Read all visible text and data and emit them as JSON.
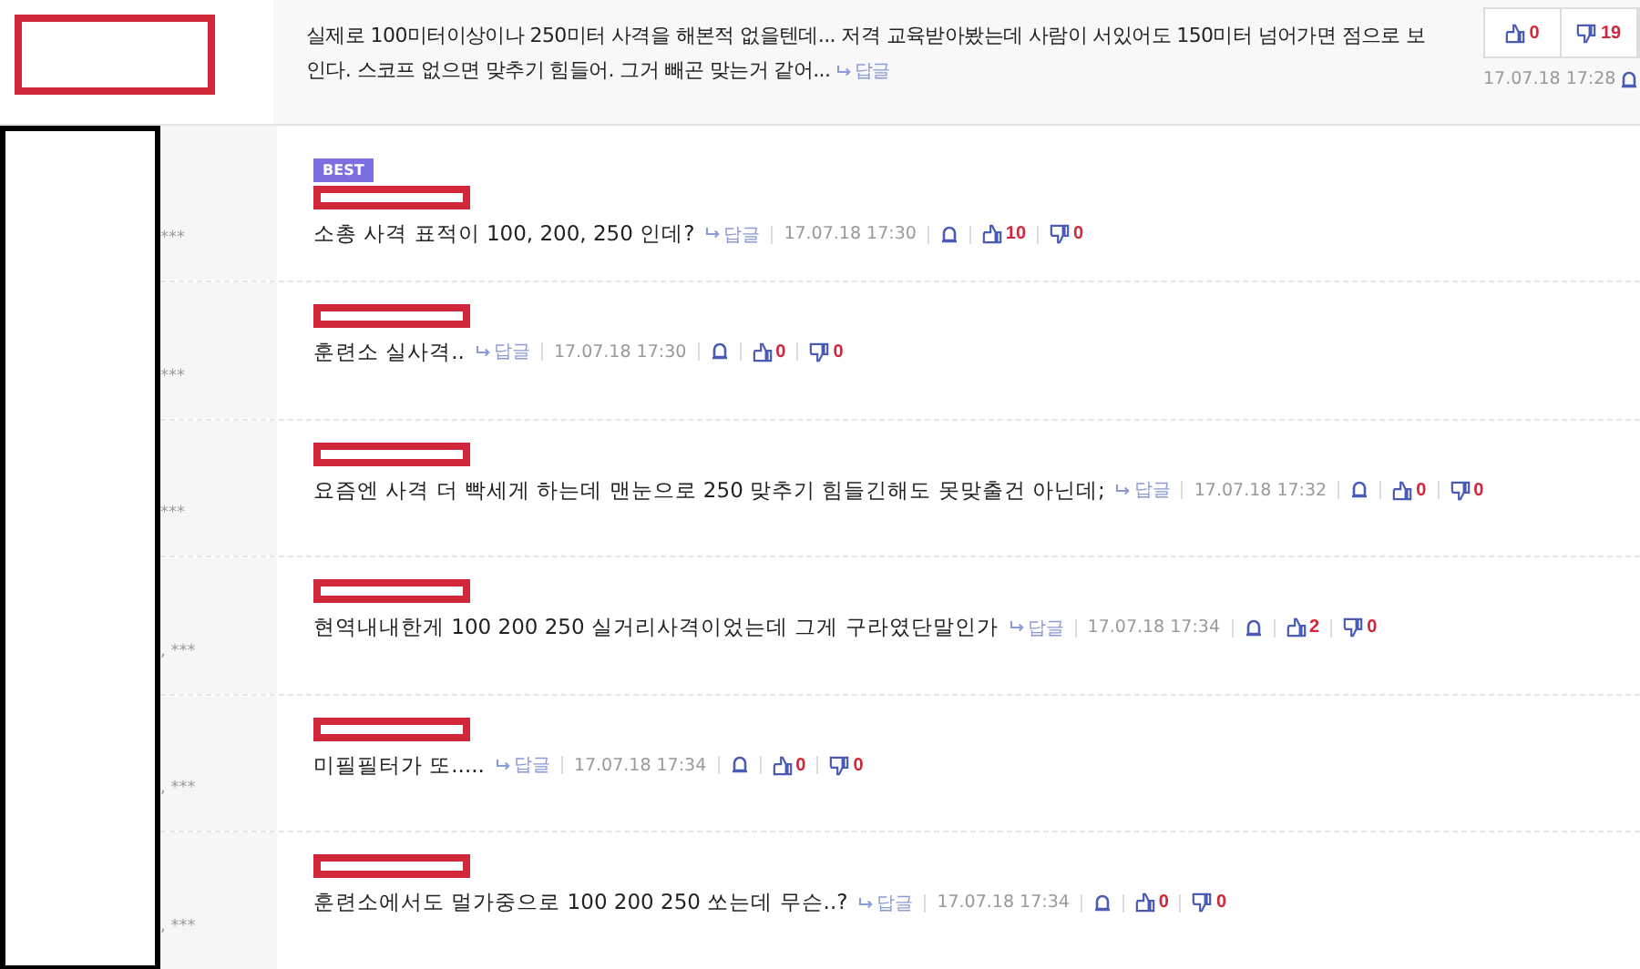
{
  "top_comment": {
    "text": "실제로 100미터이상이나 250미터 사격을 해본적 없을텐데... 저격 교육받아봤는데 사람이 서있어도  150미터 넘어가면 점으로 보인다. 스코프 없으면 맞추기 힘들어. 그거 빼곤 맞는거 같어...",
    "reply_label": "답글",
    "likes": "0",
    "dislikes": "19",
    "date": "17.07.18 17:28"
  },
  "replies": [
    {
      "masked_ip": "***",
      "badge": "BEST",
      "text": "소총 사격 표적이 100, 200, 250 인데?",
      "reply_label": "답글",
      "date": "17.07.18 17:30",
      "likes": "10",
      "dislikes": "0"
    },
    {
      "masked_ip": "***",
      "text": "훈련소 실사격..",
      "reply_label": "답글",
      "date": "17.07.18 17:30",
      "likes": "0",
      "dislikes": "0"
    },
    {
      "masked_ip": "***",
      "text": "요즘엔 사격 더 빡세게 하는데 맨눈으로 250 맞추기 힘들긴해도 못맞출건 아닌데;",
      "reply_label": "답글",
      "date": "17.07.18 17:32",
      "likes": "0",
      "dislikes": "0"
    },
    {
      "masked_ip": ", ***",
      "text": "현역내내한게 100 200 250 실거리사격이었는데 그게 구라였단말인가",
      "reply_label": "답글",
      "date": "17.07.18 17:34",
      "likes": "2",
      "dislikes": "0"
    },
    {
      "masked_ip": ", ***",
      "text": "미필필터가 또.....",
      "reply_label": "답글",
      "date": "17.07.18 17:34",
      "likes": "0",
      "dislikes": "0"
    },
    {
      "masked_ip": ", ***",
      "text": "훈련소에서도 멀가중으로 100 200 250 쏘는데 무슨..?",
      "reply_label": "답글",
      "date": "17.07.18 17:34",
      "likes": "0",
      "dislikes": "0"
    }
  ]
}
